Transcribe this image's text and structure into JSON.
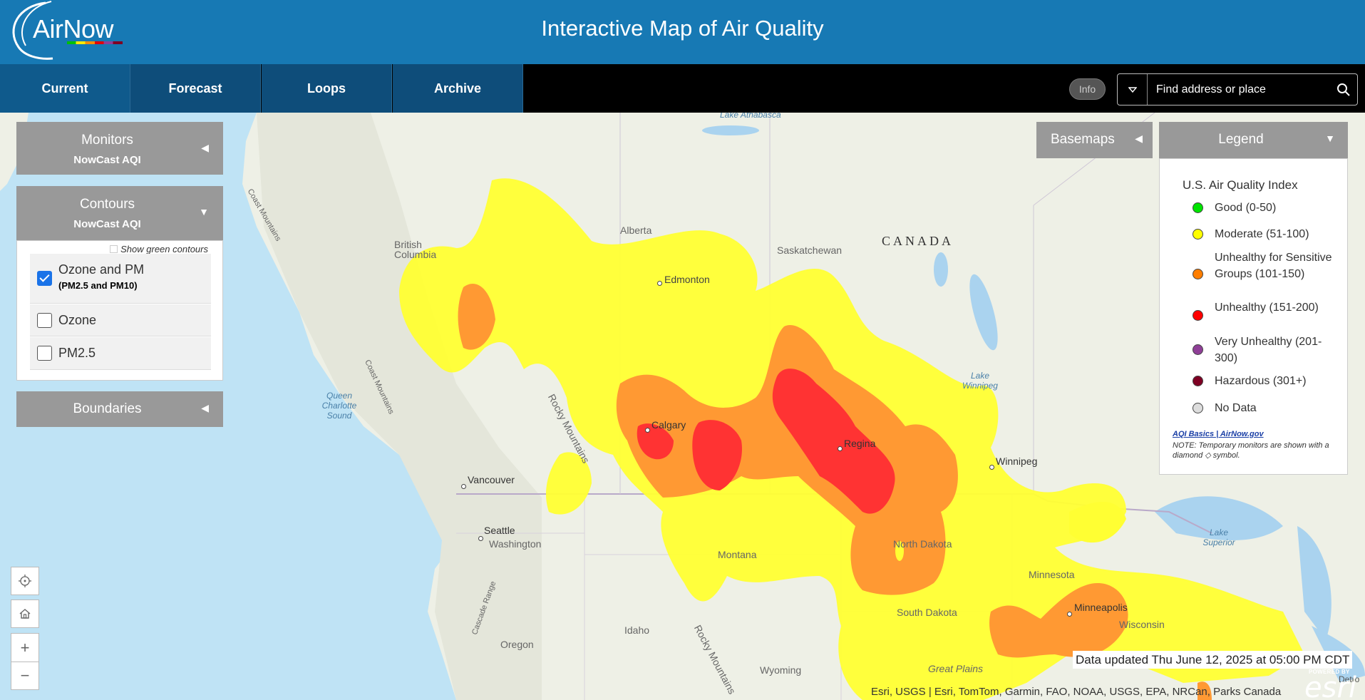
{
  "header": {
    "logo_text": "AirNow",
    "title": "Interactive Map of Air Quality"
  },
  "nav": {
    "tabs": [
      {
        "label": "Current"
      },
      {
        "label": "Forecast"
      },
      {
        "label": "Loops"
      },
      {
        "label": "Archive"
      }
    ],
    "info_label": "Info",
    "search_placeholder": "Find address or place"
  },
  "left_panels": {
    "monitors": {
      "title": "Monitors",
      "subtitle": "NowCast AQI"
    },
    "contours": {
      "title": "Contours",
      "subtitle": "NowCast AQI",
      "green_toggle_label": "Show green contours",
      "green_toggle_checked": false,
      "layers": [
        {
          "label": "Ozone and PM",
          "sub": "(PM2.5 and PM10)",
          "checked": true
        },
        {
          "label": "Ozone",
          "sub": "",
          "checked": false
        },
        {
          "label": "PM2.5",
          "sub": "",
          "checked": false
        }
      ]
    },
    "boundaries": {
      "title": "Boundaries"
    }
  },
  "right_panels": {
    "basemaps": {
      "title": "Basemaps"
    },
    "legend": {
      "title": "Legend",
      "heading": "U.S. Air Quality Index",
      "items": [
        {
          "label": "Good (0-50)",
          "color": "#00e400"
        },
        {
          "label": "Moderate (51-100)",
          "color": "#ffff00"
        },
        {
          "label": "Unhealthy for Sensitive Groups (101-150)",
          "color": "#ff7e00"
        },
        {
          "label": "Unhealthy (151-200)",
          "color": "#ff0000"
        },
        {
          "label": "Very Unhealthy (201-300)",
          "color": "#8f3f97"
        },
        {
          "label": "Hazardous (301+)",
          "color": "#7e0023"
        },
        {
          "label": "No Data",
          "color": "#dddddd"
        }
      ],
      "link_text": "AQI Basics | AirNow.gov",
      "note": "NOTE: Temporary monitors are shown with a diamond ◇ symbol."
    }
  },
  "map": {
    "labels": {
      "lake_athabasca": "Lake Athabasca",
      "alberta": "Alberta",
      "saskatchewan": "Saskatchewan",
      "canada": "CANADA",
      "british_columbia": "British Columbia",
      "edmonton": "Edmonton",
      "calgary": "Calgary",
      "regina": "Regina",
      "winnipeg": "Winnipeg",
      "lake_winnipeg": "Lake Winnipeg",
      "vancouver": "Vancouver",
      "seattle": "Seattle",
      "washington": "Washington",
      "montana": "Montana",
      "north_dakota": "North Dakota",
      "south_dakota": "South Dakota",
      "minnesota": "Minnesota",
      "minneapolis": "Minneapolis",
      "wisconsin": "Wisconsin",
      "lake_superior": "Lake Superior",
      "idaho": "Idaho",
      "oregon": "Oregon",
      "wyoming": "Wyoming",
      "great_plains": "Great Plains",
      "queen_charlotte_sound": "Queen Charlotte Sound",
      "coast_mountains_1": "Coast Mountains",
      "coast_mountains_2": "Coast Mountains",
      "rocky_mountains_1": "Rocky Mountains",
      "rocky_mountains_2": "Rocky Mountains",
      "cascade_range": "Cascade Range",
      "detroit": "Detro"
    },
    "updated": "Data updated Thu June 12, 2025 at 05:00 PM CDT",
    "attribution": "Esri, USGS | Esri, TomTom, Garmin, FAO, NOAA, USGS, EPA, NRCan, Parks Canada",
    "esri_powered": "POWERED BY",
    "esri_logo": "esri"
  },
  "colors": {
    "header": "#1779b4",
    "nav_tab": "#0e4d7a",
    "panel": "#999999",
    "moderate": "#ffff33",
    "usg": "#ff9933",
    "unhealthy": "#ff3333"
  }
}
